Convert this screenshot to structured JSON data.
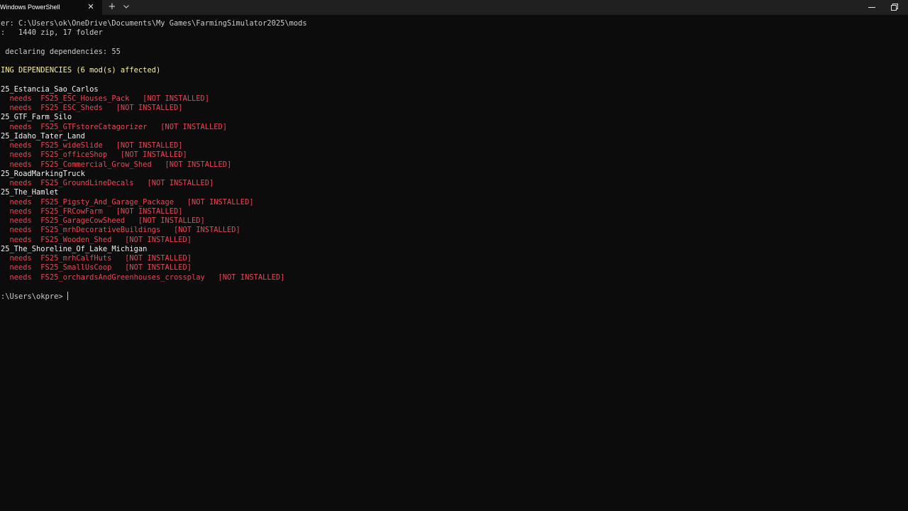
{
  "window": {
    "tab_title": "Windows PowerShell",
    "tab_close_glyph": "✕",
    "new_tab_glyph": "+",
    "icons": {
      "close": "close-icon",
      "new_tab": "plus-icon",
      "dropdown": "chevron-down-icon",
      "minimize": "minimize-icon",
      "restore": "restore-icon"
    }
  },
  "colors": {
    "background": "#0c0c0c",
    "titlebar": "#202020",
    "text": "#cccccc",
    "heading": "#f2f2f2",
    "warning": "#f9f1a5",
    "error": "#e74856"
  },
  "terminal": {
    "lines": [
      "er: C:\\Users\\ok\\OneDrive\\Documents\\My Games\\FarmingSimulator2025\\mods",
      ":   1440 zip, 17 folder",
      "",
      " declaring dependencies: 55",
      "",
      "ING DEPENDENCIES (6 mod(s) affected)",
      "",
      "25_Estancia_Sao_Carlos",
      "  needs  FS25_ESC_Houses_Pack   [NOT INSTALLED]",
      "  needs  FS25_ESC_Sheds   [NOT INSTALLED]",
      "25_GTF_Farm_Silo",
      "  needs  FS25_GTFstoreCatagorizer   [NOT INSTALLED]",
      "25_Idaho_Tater_Land",
      "  needs  FS25_wideSlide   [NOT INSTALLED]",
      "  needs  FS25_officeShop   [NOT INSTALLED]",
      "  needs  FS25_Commercial_Grow_Shed   [NOT INSTALLED]",
      "25_RoadMarkingTruck",
      "  needs  FS25_GroundLineDecals   [NOT INSTALLED]",
      "25_The_Hamlet",
      "  needs  FS25_Pigsty_And_Garage_Package   [NOT INSTALLED]",
      "  needs  FS25_FRCowFarm   [NOT INSTALLED]",
      "  needs  FS25_GarageCowSheed   [NOT INSTALLED]",
      "  needs  FS25_mrhDecorativeBuildings   [NOT INSTALLED]",
      "  needs  FS25_Wooden_Shed   [NOT INSTALLED]",
      "25_The_Shoreline_Of_Lake_Michigan",
      "  needs  FS25_mrhCalfHuts   [NOT INSTALLED]",
      "  needs  FS25_SmallUsCoop   [NOT INSTALLED]",
      "  needs  FS25_orchardsAndGreenhouses_crossplay   [NOT INSTALLED]",
      "",
      ":\\Users\\okpre> "
    ]
  }
}
